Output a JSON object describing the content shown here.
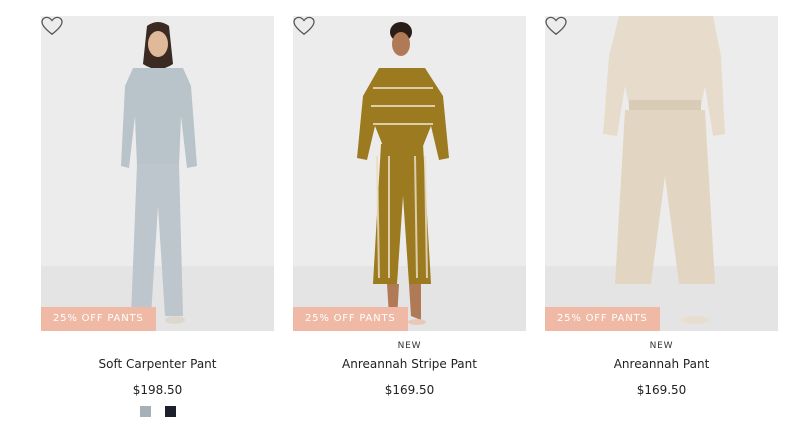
{
  "colors": {
    "promo_bg": "#f0b9a5",
    "photo_bg": "#ececec"
  },
  "products": [
    {
      "name": "Soft Carpenter Pant",
      "price": "$198.50",
      "badge": "",
      "promo": "25% OFF PANTS",
      "wishlist_icon": "heart-outline-icon",
      "swatches": [
        {
          "color": "#a7b0b6"
        },
        {
          "color": "#1d1f2b"
        }
      ]
    },
    {
      "name": "Anreannah Stripe Pant",
      "price": "$169.50",
      "badge": "NEW",
      "promo": "25% OFF PANTS",
      "wishlist_icon": "heart-outline-icon",
      "swatches": []
    },
    {
      "name": "Anreannah Pant",
      "price": "$169.50",
      "badge": "NEW",
      "promo": "25% OFF PANTS",
      "wishlist_icon": "heart-outline-icon",
      "swatches": []
    }
  ]
}
